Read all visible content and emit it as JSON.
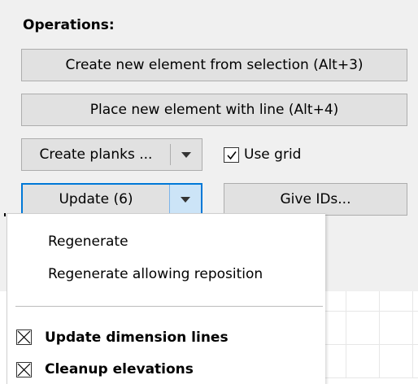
{
  "operations": {
    "title": "Operations:",
    "create_from_selection": "Create new element from selection (Alt+3)",
    "place_with_line": "Place new element with line (Alt+4)",
    "create_planks": "Create planks ...",
    "use_grid": {
      "label": "Use grid",
      "checked": true
    },
    "update": "Update (6)",
    "give_ids": "Give IDs..."
  },
  "update_menu": {
    "items": [
      {
        "label": "Regenerate"
      },
      {
        "label": "Regenerate allowing reposition"
      }
    ],
    "options": [
      {
        "label": "Update dimension lines",
        "checked": true
      },
      {
        "label": "Cleanup elevations",
        "checked": true
      }
    ]
  },
  "icons": {
    "dropdown_arrow": "chevron-down-icon",
    "checkmark": "checkmark-icon",
    "cross_mark": "cross-checkbox-icon"
  }
}
